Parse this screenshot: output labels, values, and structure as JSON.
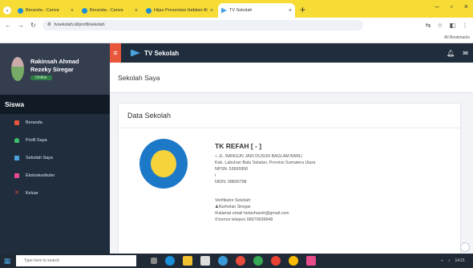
{
  "browser": {
    "tabs": [
      {
        "title": "Beranda - Canva",
        "favicon": "canva-icon",
        "color": "#1b8fd8"
      },
      {
        "title": "Beranda - Canva",
        "favicon": "canva-icon",
        "color": "#1b8fd8"
      },
      {
        "title": "Hijau Presentasi Hafalan Al Qu...",
        "favicon": "canva-icon",
        "color": "#1b8fd8"
      },
      {
        "title": "TV Sekolah",
        "favicon": "tvsekolah-icon",
        "color": "#4aa3df"
      }
    ],
    "url": "tvsekolah.id/profil/sekolah",
    "bookmarks_label": "All Bookmarks"
  },
  "app": {
    "brand": "TV Sekolah",
    "user": {
      "name": "Rakinsah Ahmad Rezeky Siregar",
      "status": "Online"
    },
    "menu_header": "Siswa",
    "menu": [
      {
        "label": "Beranda",
        "icon": "home-icon",
        "color": "#e8563c"
      },
      {
        "label": "Profil Saya",
        "icon": "user-icon",
        "color": "#3fbf6b"
      },
      {
        "label": "Sekolah Saya",
        "icon": "school-icon",
        "color": "#4aa3df"
      },
      {
        "label": "Ekstrakurikuler",
        "icon": "trophy-icon",
        "color": "#e84b8a"
      },
      {
        "label": "Keluar",
        "icon": "close-icon",
        "color": "#e84b3c"
      }
    ],
    "page_title": "Sekolah Saya",
    "card_title": "Data Sekolah",
    "school": {
      "name": "TK REFAH [ - ]",
      "address": "JL. BANGUN JADI DUSUN BAGLAM BARU",
      "city": "Kab. Labuhan Batu Selatan, Provinsi Sumatera Utara",
      "npsn": "NPSN: 53665950",
      "line": "i",
      "nisn": "NIDN: 08800798"
    },
    "verifier": {
      "label": "Verifikator Sekolah:",
      "name": "Nurhelan Siregar",
      "email": "alamat email helanhasim@gmail.com",
      "phone": "nomor telepon 08970699848"
    }
  },
  "taskbar": {
    "search_placeholder": "Type here to search",
    "time": "14:21"
  }
}
